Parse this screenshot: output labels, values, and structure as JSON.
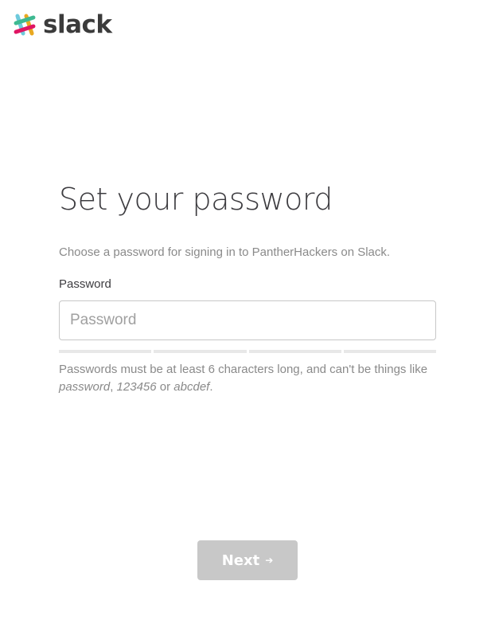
{
  "header": {
    "logo_text": "slack",
    "logo_icon": "slack-hash-icon"
  },
  "main": {
    "title": "Set your password",
    "subtitle": "Choose a password for signing in to PantherHackers on Slack.",
    "password_label": "Password",
    "password_placeholder": "Password",
    "password_value": "",
    "strength_segments": 4,
    "hint": {
      "prefix": "Passwords must be at least 6 characters long, and can't be things like ",
      "example1": "password",
      "sep1": ", ",
      "example2": "123456",
      "sep2": " or ",
      "example3": "abcdef",
      "suffix": "."
    }
  },
  "footer": {
    "next_label": "Next",
    "next_icon": "arrow-right-icon"
  },
  "colors": {
    "logo_green": "#3eb991",
    "logo_blue": "#6ecadc",
    "logo_yellow": "#e9a820",
    "logo_red": "#e01563",
    "button_disabled": "#c8c8c8",
    "muted_text": "#8a8a8a"
  }
}
